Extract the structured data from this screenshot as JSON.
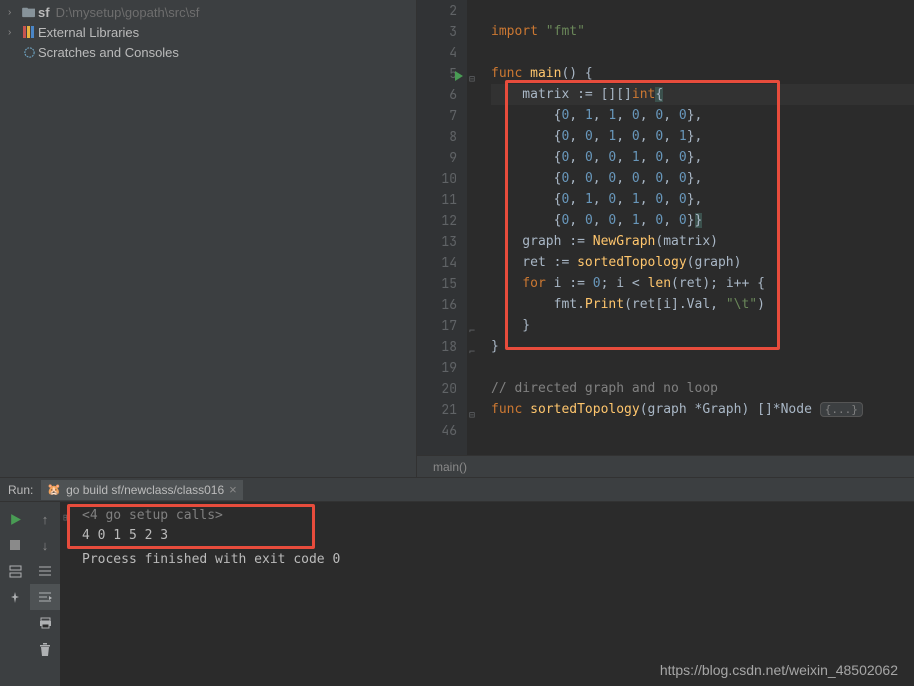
{
  "project": {
    "root_name": "sf",
    "root_path": "D:\\mysetup\\gopath\\src\\sf",
    "external_libraries": "External Libraries",
    "scratches": "Scratches and Consoles"
  },
  "code": {
    "line_start": 2,
    "lines": [
      {
        "n": 2,
        "tokens": []
      },
      {
        "n": 3,
        "tokens": [
          {
            "cls": "kw",
            "t": "import "
          },
          {
            "cls": "str",
            "t": "\"fmt\""
          }
        ]
      },
      {
        "n": 4,
        "tokens": []
      },
      {
        "n": 5,
        "run": true,
        "fold": "open",
        "tokens": [
          {
            "cls": "kw",
            "t": "func "
          },
          {
            "cls": "func",
            "t": "main"
          },
          {
            "cls": "punct",
            "t": "() {"
          }
        ]
      },
      {
        "n": 6,
        "caret": true,
        "tokens": [
          {
            "cls": "ident",
            "t": "    matrix := []"
          },
          {
            "cls": "punct",
            "t": "[]"
          },
          {
            "cls": "typ",
            "t": "int"
          },
          {
            "cls": "hl",
            "t": "{"
          }
        ]
      },
      {
        "n": 7,
        "tokens": [
          {
            "cls": "punct",
            "t": "        {"
          },
          {
            "cls": "num",
            "t": "0"
          },
          {
            "cls": "punct",
            "t": ", "
          },
          {
            "cls": "num",
            "t": "1"
          },
          {
            "cls": "punct",
            "t": ", "
          },
          {
            "cls": "num",
            "t": "1"
          },
          {
            "cls": "punct",
            "t": ", "
          },
          {
            "cls": "num",
            "t": "0"
          },
          {
            "cls": "punct",
            "t": ", "
          },
          {
            "cls": "num",
            "t": "0"
          },
          {
            "cls": "punct",
            "t": ", "
          },
          {
            "cls": "num",
            "t": "0"
          },
          {
            "cls": "punct",
            "t": "},"
          }
        ]
      },
      {
        "n": 8,
        "tokens": [
          {
            "cls": "punct",
            "t": "        {"
          },
          {
            "cls": "num",
            "t": "0"
          },
          {
            "cls": "punct",
            "t": ", "
          },
          {
            "cls": "num",
            "t": "0"
          },
          {
            "cls": "punct",
            "t": ", "
          },
          {
            "cls": "num",
            "t": "1"
          },
          {
            "cls": "punct",
            "t": ", "
          },
          {
            "cls": "num",
            "t": "0"
          },
          {
            "cls": "punct",
            "t": ", "
          },
          {
            "cls": "num",
            "t": "0"
          },
          {
            "cls": "punct",
            "t": ", "
          },
          {
            "cls": "num",
            "t": "1"
          },
          {
            "cls": "punct",
            "t": "},"
          }
        ]
      },
      {
        "n": 9,
        "tokens": [
          {
            "cls": "punct",
            "t": "        {"
          },
          {
            "cls": "num",
            "t": "0"
          },
          {
            "cls": "punct",
            "t": ", "
          },
          {
            "cls": "num",
            "t": "0"
          },
          {
            "cls": "punct",
            "t": ", "
          },
          {
            "cls": "num",
            "t": "0"
          },
          {
            "cls": "punct",
            "t": ", "
          },
          {
            "cls": "num",
            "t": "1"
          },
          {
            "cls": "punct",
            "t": ", "
          },
          {
            "cls": "num",
            "t": "0"
          },
          {
            "cls": "punct",
            "t": ", "
          },
          {
            "cls": "num",
            "t": "0"
          },
          {
            "cls": "punct",
            "t": "},"
          }
        ]
      },
      {
        "n": 10,
        "tokens": [
          {
            "cls": "punct",
            "t": "        {"
          },
          {
            "cls": "num",
            "t": "0"
          },
          {
            "cls": "punct",
            "t": ", "
          },
          {
            "cls": "num",
            "t": "0"
          },
          {
            "cls": "punct",
            "t": ", "
          },
          {
            "cls": "num",
            "t": "0"
          },
          {
            "cls": "punct",
            "t": ", "
          },
          {
            "cls": "num",
            "t": "0"
          },
          {
            "cls": "punct",
            "t": ", "
          },
          {
            "cls": "num",
            "t": "0"
          },
          {
            "cls": "punct",
            "t": ", "
          },
          {
            "cls": "num",
            "t": "0"
          },
          {
            "cls": "punct",
            "t": "},"
          }
        ]
      },
      {
        "n": 11,
        "tokens": [
          {
            "cls": "punct",
            "t": "        {"
          },
          {
            "cls": "num",
            "t": "0"
          },
          {
            "cls": "punct",
            "t": ", "
          },
          {
            "cls": "num",
            "t": "1"
          },
          {
            "cls": "punct",
            "t": ", "
          },
          {
            "cls": "num",
            "t": "0"
          },
          {
            "cls": "punct",
            "t": ", "
          },
          {
            "cls": "num",
            "t": "1"
          },
          {
            "cls": "punct",
            "t": ", "
          },
          {
            "cls": "num",
            "t": "0"
          },
          {
            "cls": "punct",
            "t": ", "
          },
          {
            "cls": "num",
            "t": "0"
          },
          {
            "cls": "punct",
            "t": "},"
          }
        ]
      },
      {
        "n": 12,
        "tokens": [
          {
            "cls": "punct",
            "t": "        {"
          },
          {
            "cls": "num",
            "t": "0"
          },
          {
            "cls": "punct",
            "t": ", "
          },
          {
            "cls": "num",
            "t": "0"
          },
          {
            "cls": "punct",
            "t": ", "
          },
          {
            "cls": "num",
            "t": "0"
          },
          {
            "cls": "punct",
            "t": ", "
          },
          {
            "cls": "num",
            "t": "1"
          },
          {
            "cls": "punct",
            "t": ", "
          },
          {
            "cls": "num",
            "t": "0"
          },
          {
            "cls": "punct",
            "t": ", "
          },
          {
            "cls": "num",
            "t": "0"
          },
          {
            "cls": "punct",
            "t": "}"
          },
          {
            "cls": "hl",
            "t": "}"
          }
        ]
      },
      {
        "n": 13,
        "tokens": [
          {
            "cls": "ident",
            "t": "    graph := "
          },
          {
            "cls": "func",
            "t": "NewGraph"
          },
          {
            "cls": "punct",
            "t": "(matrix)"
          }
        ]
      },
      {
        "n": 14,
        "tokens": [
          {
            "cls": "ident",
            "t": "    ret := "
          },
          {
            "cls": "func",
            "t": "sortedTopology"
          },
          {
            "cls": "punct",
            "t": "(graph)"
          }
        ]
      },
      {
        "n": 15,
        "tokens": [
          {
            "cls": "kw",
            "t": "    for "
          },
          {
            "cls": "ident",
            "t": "i := "
          },
          {
            "cls": "num",
            "t": "0"
          },
          {
            "cls": "punct",
            "t": "; i < "
          },
          {
            "cls": "func",
            "t": "len"
          },
          {
            "cls": "punct",
            "t": "(ret); i++ {"
          }
        ]
      },
      {
        "n": 16,
        "tokens": [
          {
            "cls": "ident",
            "t": "        fmt."
          },
          {
            "cls": "func",
            "t": "Print"
          },
          {
            "cls": "punct",
            "t": "(ret[i].Val, "
          },
          {
            "cls": "str",
            "t": "\"\\t\""
          },
          {
            "cls": "punct",
            "t": ")"
          }
        ]
      },
      {
        "n": 17,
        "fold": "close",
        "tokens": [
          {
            "cls": "punct",
            "t": "    }"
          }
        ]
      },
      {
        "n": 18,
        "fold": "close",
        "tokens": [
          {
            "cls": "punct",
            "t": "}"
          }
        ]
      },
      {
        "n": 19,
        "tokens": []
      },
      {
        "n": 20,
        "tokens": [
          {
            "cls": "comment",
            "t": "// directed graph and no loop"
          }
        ]
      },
      {
        "n": 21,
        "fold": "open",
        "tokens": [
          {
            "cls": "kw",
            "t": "func "
          },
          {
            "cls": "func",
            "t": "sortedTopology"
          },
          {
            "cls": "punct",
            "t": "(graph *Graph) []*Node "
          },
          {
            "cls": "foldbox",
            "t": "{...}"
          }
        ]
      },
      {
        "n": 46,
        "tokens": []
      }
    ]
  },
  "breadcrumb": "main()",
  "run": {
    "title": "Run:",
    "tab_name": "go build sf/newclass/class016",
    "console": {
      "fold": "<4 go setup calls>",
      "output": "4    0    1    5    2    3",
      "finished": "Process finished with exit code 0"
    }
  },
  "watermark": "https://blog.csdn.net/weixin_48502062"
}
